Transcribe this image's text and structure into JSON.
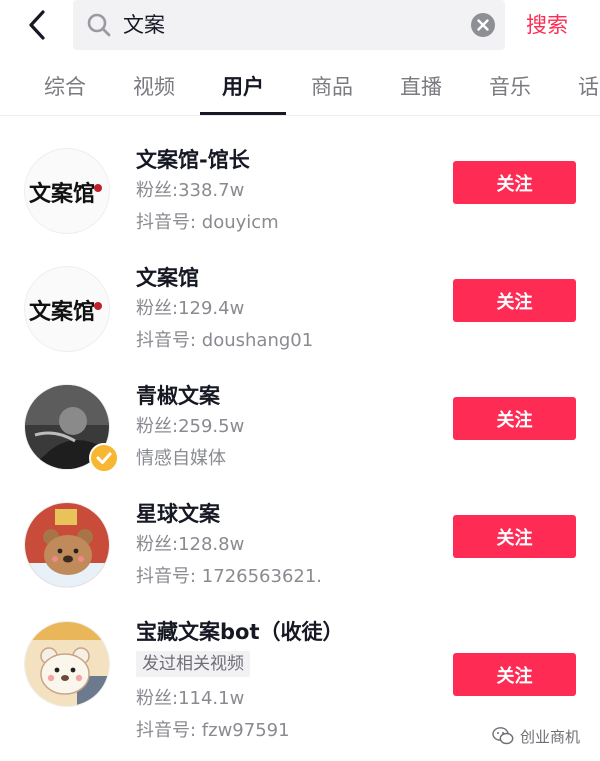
{
  "search": {
    "query": "文案",
    "submit_label": "搜索",
    "back_icon": "chevron-left-icon",
    "search_icon": "search-icon",
    "clear_icon": "clear-icon"
  },
  "tabs": [
    {
      "label": "综合",
      "active": false
    },
    {
      "label": "视频",
      "active": false
    },
    {
      "label": "用户",
      "active": true
    },
    {
      "label": "商品",
      "active": false
    },
    {
      "label": "直播",
      "active": false
    },
    {
      "label": "音乐",
      "active": false
    },
    {
      "label": "话",
      "active": false
    }
  ],
  "users": [
    {
      "name": "文案馆-馆长",
      "tag": "",
      "fans": "粉丝:338.7w",
      "sub": "抖音号: douyicm",
      "follow_label": "关注",
      "avatar": "calligraphy-logo",
      "avatar_text": "文案馆",
      "verified": false
    },
    {
      "name": "文案馆",
      "tag": "",
      "fans": "粉丝:129.4w",
      "sub": "抖音号: doushang01",
      "follow_label": "关注",
      "avatar": "calligraphy-logo",
      "avatar_text": "文案馆",
      "verified": false
    },
    {
      "name": "青椒文案",
      "tag": "",
      "fans": "粉丝:259.5w",
      "sub": "情感自媒体",
      "follow_label": "关注",
      "avatar": "photo-person",
      "verified": true
    },
    {
      "name": "星球文案",
      "tag": "",
      "fans": "粉丝:128.8w",
      "sub": "抖音号: 1726563621.",
      "follow_label": "关注",
      "avatar": "cartoon-bear",
      "verified": false
    },
    {
      "name": "宝藏文案bot（收徒）",
      "tag": "发过相关视频",
      "fans": "粉丝:114.1w",
      "sub": "抖音号: fzw97591",
      "follow_label": "关注",
      "avatar": "cartoon-bear",
      "verified": false
    }
  ],
  "watermark": {
    "text": "创业商机",
    "icon": "wechat-icon"
  },
  "colors": {
    "accent": "#fe2c55",
    "text": "#161823",
    "muted": "#8a8b91",
    "search_bg": "#f2f2f4",
    "verified": "#f7b731"
  }
}
